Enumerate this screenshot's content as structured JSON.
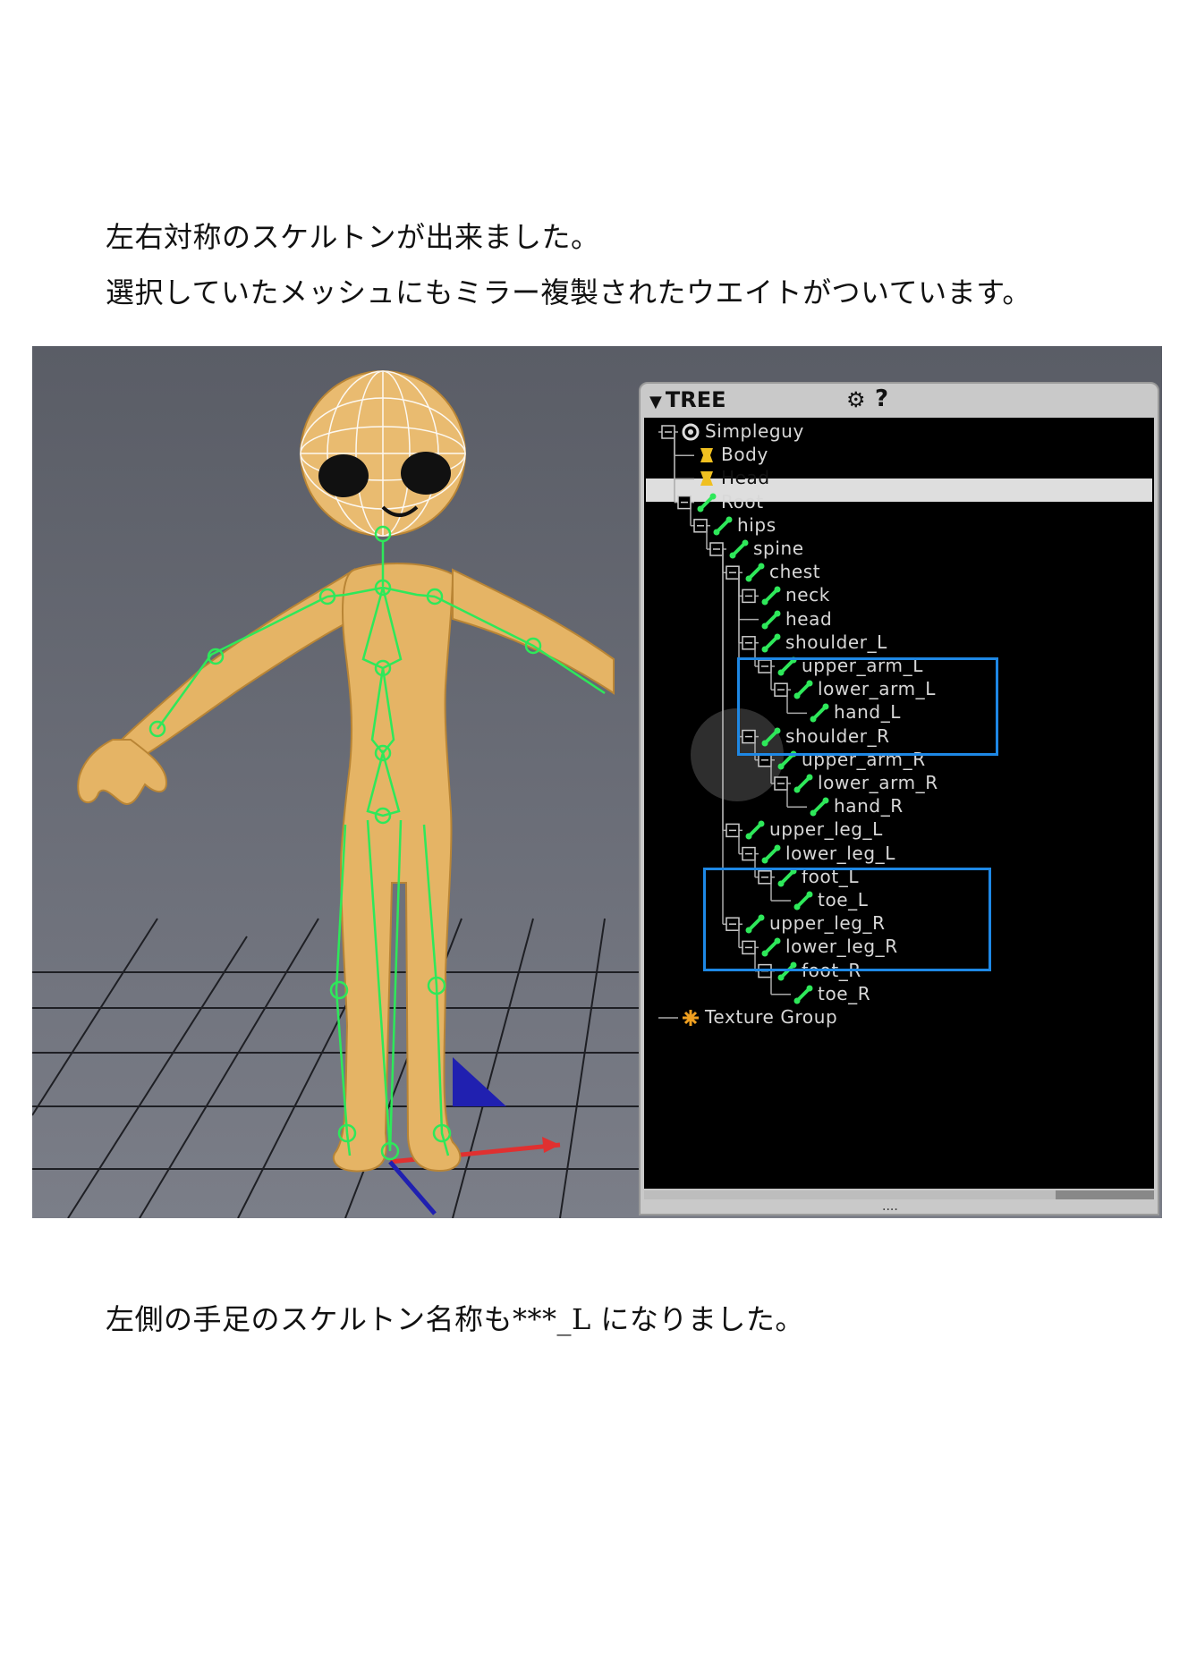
{
  "document": {
    "paragraphs": [
      "左右対称のスケルトンが出来ました。",
      "選択していたメッシュにもミラー複製されたウエイトがついています。",
      "左側の手足のスケルトン名称も***_L になりました。"
    ]
  },
  "tree_panel": {
    "title": "TREE",
    "gear_icon": "gear-icon",
    "help_icon": "?",
    "selected": "Head",
    "nodes": [
      {
        "label": "Simpleguy",
        "icon": "scene-icon"
      },
      {
        "label": "Body",
        "icon": "mesh-icon"
      },
      {
        "label": "Head",
        "icon": "mesh-icon"
      },
      {
        "label": "Root",
        "icon": "bone-icon"
      },
      {
        "label": "hips",
        "icon": "bone-icon"
      },
      {
        "label": "spine",
        "icon": "bone-icon"
      },
      {
        "label": "chest",
        "icon": "bone-icon"
      },
      {
        "label": "neck",
        "icon": "bone-icon"
      },
      {
        "label": "head",
        "icon": "bone-icon"
      },
      {
        "label": "shoulder_L",
        "icon": "bone-icon"
      },
      {
        "label": "upper_arm_L",
        "icon": "bone-icon"
      },
      {
        "label": "lower_arm_L",
        "icon": "bone-icon"
      },
      {
        "label": "hand_L",
        "icon": "bone-icon"
      },
      {
        "label": "shoulder_R",
        "icon": "bone-icon"
      },
      {
        "label": "upper_arm_R",
        "icon": "bone-icon"
      },
      {
        "label": "lower_arm_R",
        "icon": "bone-icon"
      },
      {
        "label": "hand_R",
        "icon": "bone-icon"
      },
      {
        "label": "upper_leg_L",
        "icon": "bone-icon"
      },
      {
        "label": "lower_leg_L",
        "icon": "bone-icon"
      },
      {
        "label": "foot_L",
        "icon": "bone-icon"
      },
      {
        "label": "toe_L",
        "icon": "bone-icon"
      },
      {
        "label": "upper_leg_R",
        "icon": "bone-icon"
      },
      {
        "label": "lower_leg_R",
        "icon": "bone-icon"
      },
      {
        "label": "foot_R",
        "icon": "bone-icon"
      },
      {
        "label": "toe_R",
        "icon": "bone-icon"
      },
      {
        "label": "Texture Group",
        "icon": "texture-group-icon"
      }
    ]
  },
  "colors": {
    "bone": "#2ee85a",
    "highlight_box": "#1e88e5",
    "selection_bar": "#dedede",
    "mesh_icon": "#f0c020",
    "texture_icon": "#f0a020",
    "skin": "#e8b870"
  }
}
